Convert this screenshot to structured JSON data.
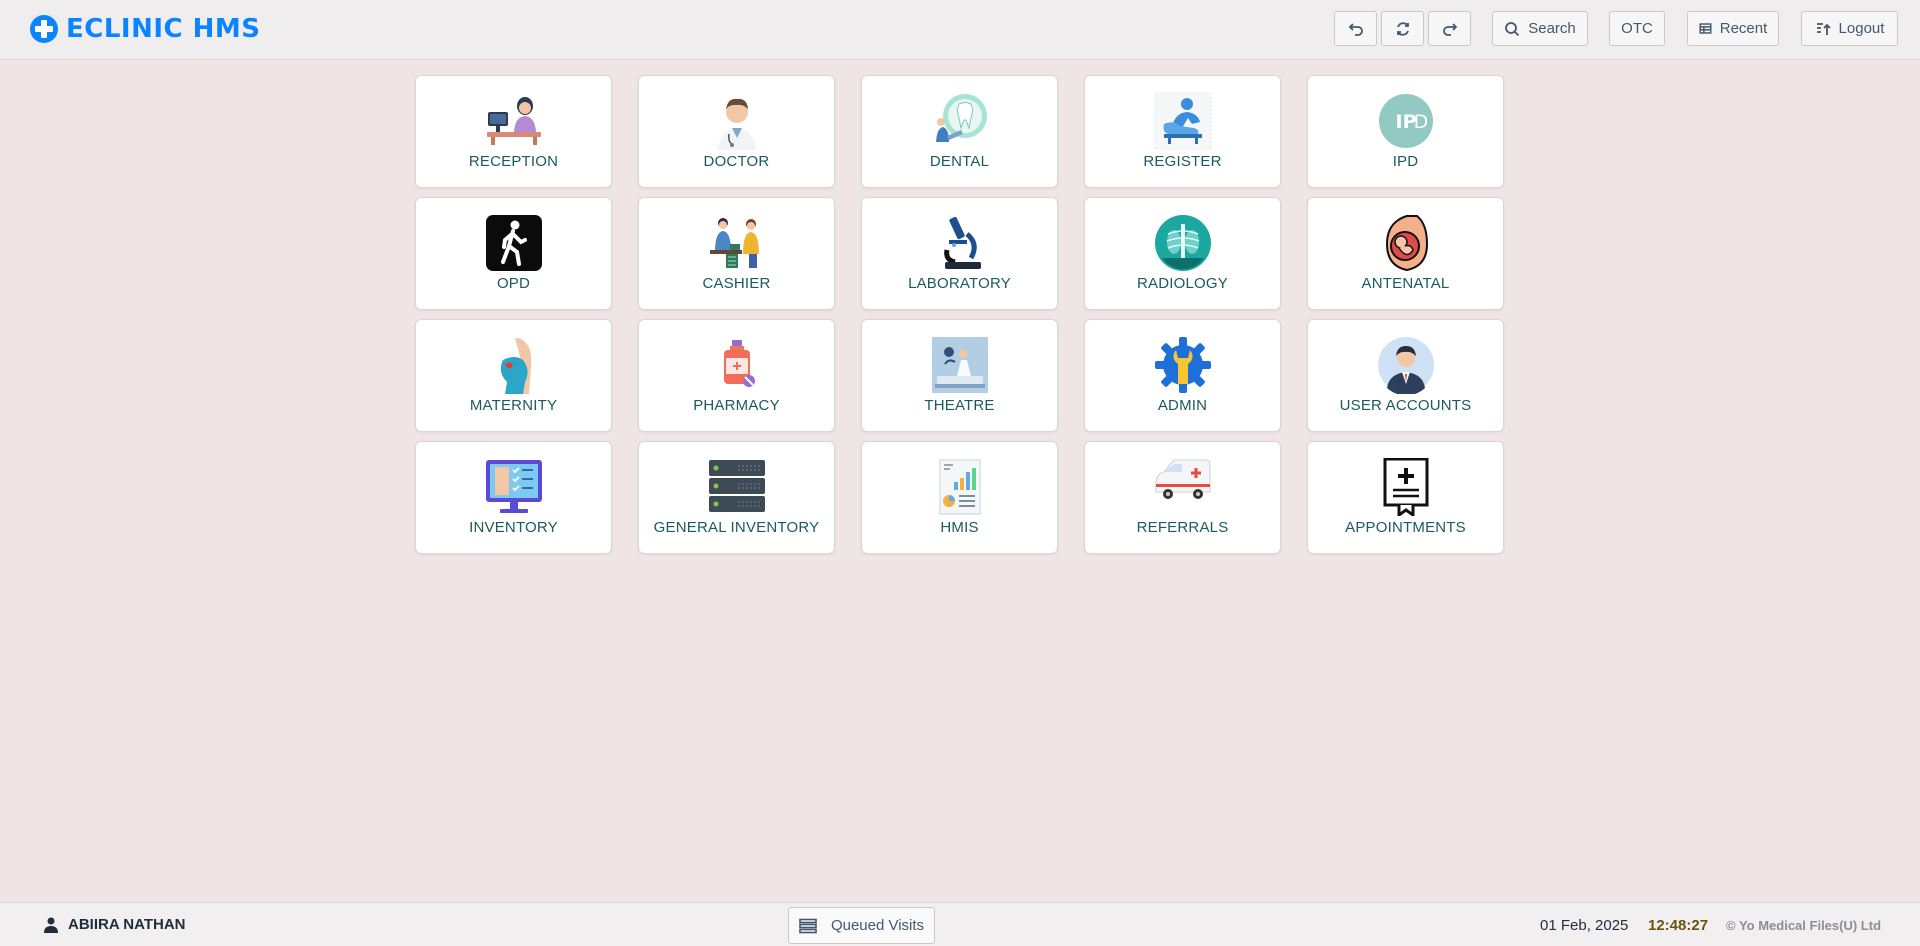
{
  "header": {
    "brand": "ECLINIC HMS",
    "buttons": {
      "back_icon": "undo-arrow-icon",
      "refresh_icon": "refresh-icon",
      "forward_icon": "redo-arrow-icon",
      "search": "Search",
      "otc": "OTC",
      "recent": "Recent",
      "logout": "Logout"
    }
  },
  "modules": [
    {
      "label": "RECEPTION",
      "icon": "reception-icon"
    },
    {
      "label": "DOCTOR",
      "icon": "doctor-icon"
    },
    {
      "label": "DENTAL",
      "icon": "dental-icon"
    },
    {
      "label": "REGISTER",
      "icon": "register-icon"
    },
    {
      "label": "IPD",
      "icon": "ipd-icon"
    },
    {
      "label": "OPD",
      "icon": "opd-walking-icon"
    },
    {
      "label": "CASHIER",
      "icon": "cashier-icon"
    },
    {
      "label": "LABORATORY",
      "icon": "microscope-icon"
    },
    {
      "label": "RADIOLOGY",
      "icon": "xray-icon"
    },
    {
      "label": "ANTENATAL",
      "icon": "fetus-icon"
    },
    {
      "label": "MATERNITY",
      "icon": "pregnant-woman-icon"
    },
    {
      "label": "PHARMACY",
      "icon": "medicine-bottle-icon"
    },
    {
      "label": "THEATRE",
      "icon": "operating-theatre-icon"
    },
    {
      "label": "ADMIN",
      "icon": "gear-wrench-icon"
    },
    {
      "label": "USER ACCOUNTS",
      "icon": "user-avatar-icon"
    },
    {
      "label": "INVENTORY",
      "icon": "checklist-monitor-icon"
    },
    {
      "label": "GENERAL INVENTORY",
      "icon": "server-rack-icon"
    },
    {
      "label": "HMIS",
      "icon": "report-chart-icon"
    },
    {
      "label": "REFERRALS",
      "icon": "ambulance-icon"
    },
    {
      "label": "APPOINTMENTS",
      "icon": "appointment-certificate-icon"
    }
  ],
  "footer": {
    "user": "ABIIRA NATHAN",
    "queued": "Queued Visits",
    "date": "01 Feb, 2025",
    "time": "12:48:27",
    "copyright": "© Yo Medical Files(U) Ltd"
  },
  "colors": {
    "brand": "#0a84ff",
    "tile_label": "#1c5a5e",
    "background": "#efe5e5",
    "time": "#6b5410"
  }
}
